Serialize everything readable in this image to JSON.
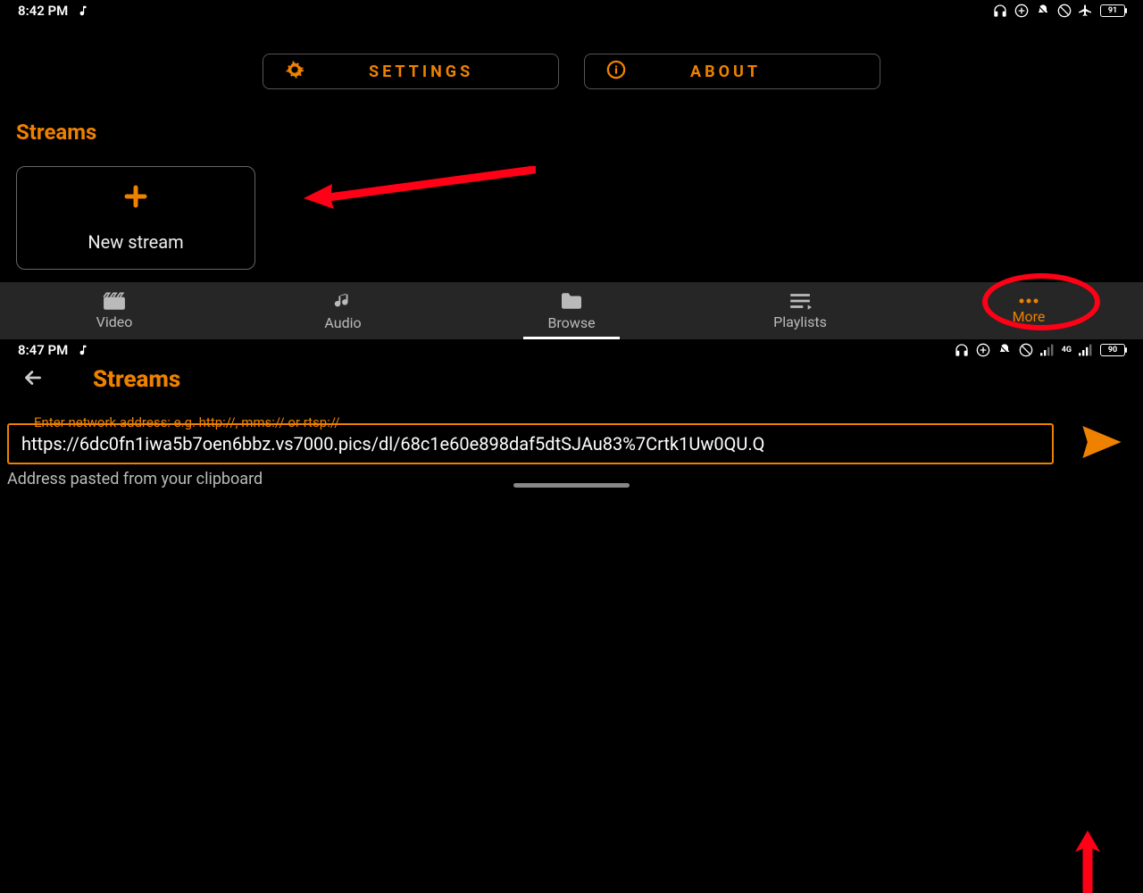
{
  "screen1": {
    "status": {
      "time": "8:42 PM",
      "battery": "91"
    },
    "top_buttons": {
      "settings": "SETTINGS",
      "about": "ABOUT"
    },
    "section_title": "Streams",
    "stream_card": {
      "label": "New stream"
    },
    "nav": [
      {
        "label": "Video"
      },
      {
        "label": "Audio"
      },
      {
        "label": "Browse"
      },
      {
        "label": "Playlists"
      },
      {
        "label": "More"
      }
    ]
  },
  "screen2": {
    "status": {
      "time": "8:47 PM",
      "battery": "90"
    },
    "title": "Streams",
    "input_label": "Enter network address: e.g. http://, mms:// or rtsp://",
    "input_value": "https://6dc0fn1iwa5b7oen6bbz.vs7000.pics/dl/68c1e60e898daf5dtSJAu83%7Crtk1Uw0QU.Q",
    "helper": "Address pasted from your clipboard"
  }
}
